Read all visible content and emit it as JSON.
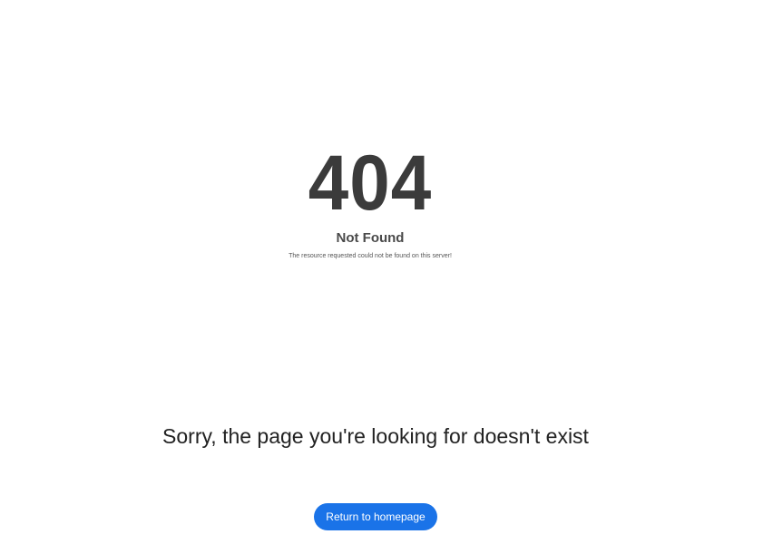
{
  "error": {
    "code": "404",
    "title": "Not Found",
    "description": "The resource requested could not be found on this server!"
  },
  "message": {
    "text": "Sorry, the page you're looking for doesn't exist"
  },
  "actions": {
    "home_button_label": "Return to homepage"
  },
  "colors": {
    "button_bg": "#1a73e8",
    "button_text": "#ffffff",
    "heading_text": "#3b3b3b",
    "body_text": "#222222",
    "background": "#ffffff"
  }
}
